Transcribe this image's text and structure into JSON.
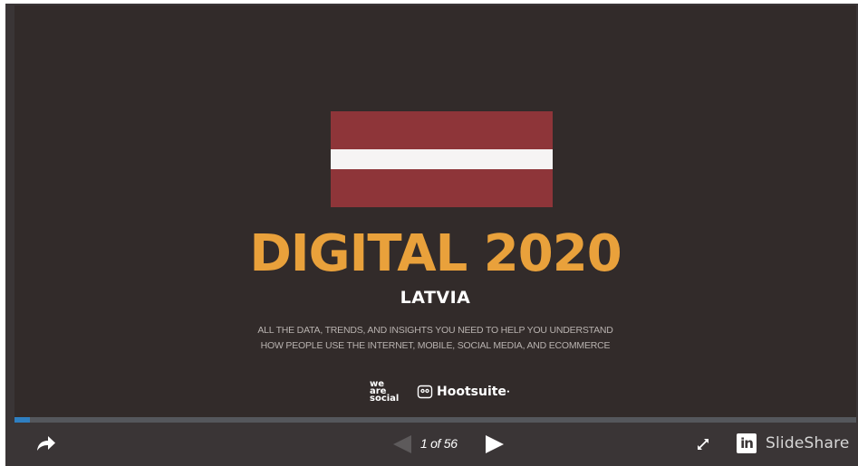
{
  "slide": {
    "title": "DIGITAL 2020",
    "country": "LATVIA",
    "subtitle_line1": "ALL THE DATA, TRENDS, AND INSIGHTS YOU NEED TO HELP YOU UNDERSTAND",
    "subtitle_line2": "HOW PEOPLE USE THE INTERNET, MOBILE, SOCIAL MEDIA, AND ECOMMERCE",
    "logo_was": [
      "we",
      "are",
      "social"
    ],
    "logo_hootsuite": "Hootsuite",
    "flag_colors": {
      "red": "#8e3539",
      "white": "#f6f4f4"
    },
    "title_color": "#e9a13b",
    "background": "#322b2a"
  },
  "player": {
    "current_slide": 1,
    "total_slides": 56,
    "counter_text": "1 of 56",
    "progress_fraction": 0.0179,
    "progress_color": "#2f7fc1",
    "icons": {
      "share": "share-arrow-icon",
      "prev": "previous-arrow-icon",
      "next": "next-arrow-icon",
      "fullscreen": "fullscreen-expand-icon",
      "linkedin": "linkedin-icon"
    },
    "linkedin_label": "in",
    "brand_name": "SlideShare"
  }
}
